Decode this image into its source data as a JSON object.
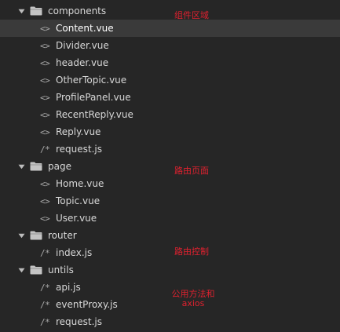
{
  "tree": [
    {
      "type": "folder",
      "depth": 0,
      "name": "components",
      "expanded": true,
      "selected": false,
      "icon": "folder-icon"
    },
    {
      "type": "file",
      "depth": 1,
      "name": "Content.vue",
      "icon_text": "<>",
      "icon": "vue-file-icon",
      "selected": true
    },
    {
      "type": "file",
      "depth": 1,
      "name": "Divider.vue",
      "icon_text": "<>",
      "icon": "vue-file-icon",
      "selected": false
    },
    {
      "type": "file",
      "depth": 1,
      "name": "header.vue",
      "icon_text": "<>",
      "icon": "vue-file-icon",
      "selected": false
    },
    {
      "type": "file",
      "depth": 1,
      "name": "OtherTopic.vue",
      "icon_text": "<>",
      "icon": "vue-file-icon",
      "selected": false
    },
    {
      "type": "file",
      "depth": 1,
      "name": "ProfilePanel.vue",
      "icon_text": "<>",
      "icon": "vue-file-icon",
      "selected": false
    },
    {
      "type": "file",
      "depth": 1,
      "name": "RecentReply.vue",
      "icon_text": "<>",
      "icon": "vue-file-icon",
      "selected": false
    },
    {
      "type": "file",
      "depth": 1,
      "name": "Reply.vue",
      "icon_text": "<>",
      "icon": "vue-file-icon",
      "selected": false
    },
    {
      "type": "file",
      "depth": 1,
      "name": "request.js",
      "icon_text": "/*",
      "icon": "js-file-icon",
      "selected": false
    },
    {
      "type": "folder",
      "depth": 0,
      "name": "page",
      "expanded": true,
      "selected": false,
      "icon": "folder-icon"
    },
    {
      "type": "file",
      "depth": 1,
      "name": "Home.vue",
      "icon_text": "<>",
      "icon": "vue-file-icon",
      "selected": false
    },
    {
      "type": "file",
      "depth": 1,
      "name": "Topic.vue",
      "icon_text": "<>",
      "icon": "vue-file-icon",
      "selected": false
    },
    {
      "type": "file",
      "depth": 1,
      "name": "User.vue",
      "icon_text": "<>",
      "icon": "vue-file-icon",
      "selected": false
    },
    {
      "type": "folder",
      "depth": 0,
      "name": "router",
      "expanded": true,
      "selected": false,
      "icon": "folder-icon"
    },
    {
      "type": "file",
      "depth": 1,
      "name": "index.js",
      "icon_text": "/*",
      "icon": "js-file-icon",
      "selected": false
    },
    {
      "type": "folder",
      "depth": 0,
      "name": "untils",
      "expanded": true,
      "selected": false,
      "icon": "folder-icon"
    },
    {
      "type": "file",
      "depth": 1,
      "name": "api.js",
      "icon_text": "/*",
      "icon": "js-file-icon",
      "selected": false
    },
    {
      "type": "file",
      "depth": 1,
      "name": "eventProxy.js",
      "icon_text": "/*",
      "icon": "js-file-icon",
      "selected": false
    },
    {
      "type": "file",
      "depth": 1,
      "name": "request.js",
      "icon_text": "/*",
      "icon": "js-file-icon",
      "selected": false
    }
  ],
  "annotations": {
    "components": "组件区域",
    "page": "路由页面",
    "router": "路由控制",
    "untils_line1": "公用方法和",
    "untils_line2": "axios"
  },
  "colors": {
    "background": "#262626",
    "selected_row": "#3a3a3a",
    "annotation": "#e0212f",
    "folder": "#c4c4c4"
  }
}
